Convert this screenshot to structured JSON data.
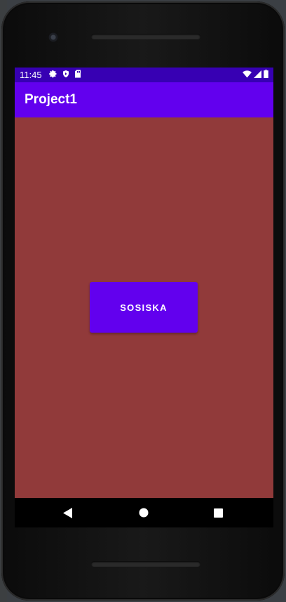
{
  "status_bar": {
    "time": "11:45",
    "icons_left": [
      "gear-icon",
      "shield-icon",
      "sd-card-icon"
    ],
    "icons_right": [
      "wifi-icon",
      "signal-icon",
      "battery-icon"
    ],
    "background": "#3700b3"
  },
  "app_bar": {
    "title": "Project1",
    "background": "#6200ee"
  },
  "content": {
    "background": "#913a3a",
    "button_label": "SOSISKA",
    "button_color": "#6200ee"
  },
  "nav_bar": {
    "buttons": [
      "back-icon",
      "home-icon",
      "recents-icon"
    ]
  }
}
